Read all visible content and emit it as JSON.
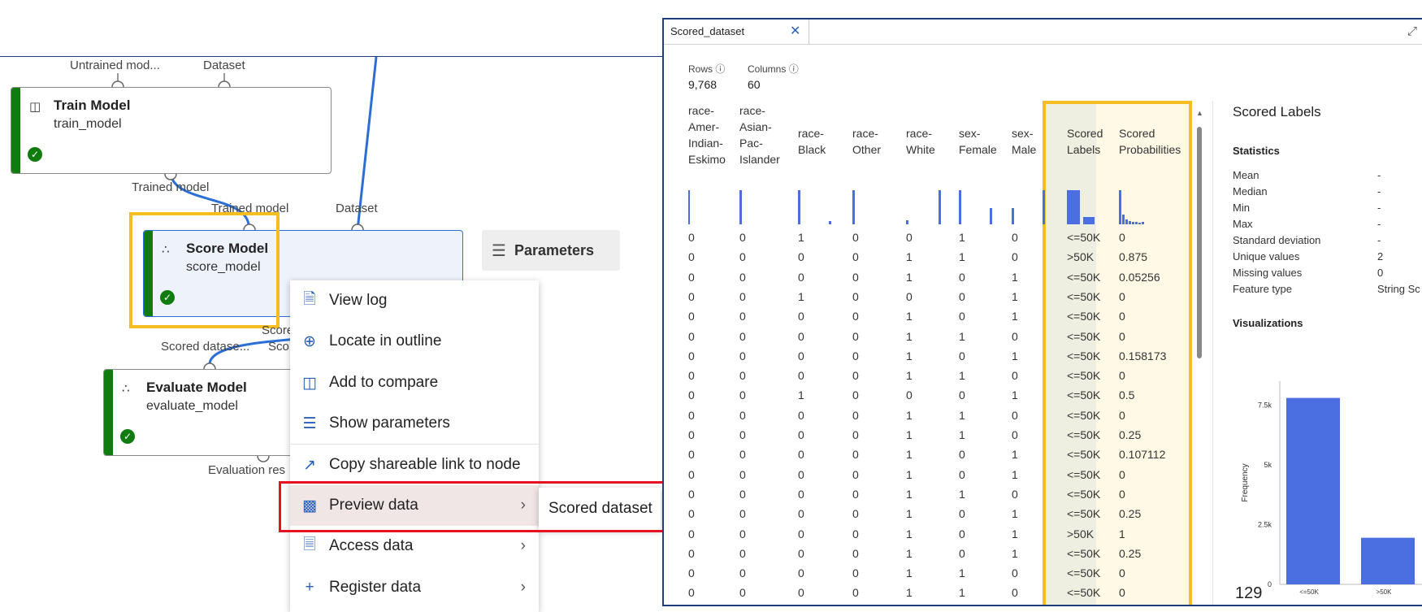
{
  "pipeline": {
    "top_ports": {
      "untrained": "Untrained mod...",
      "dataset": "Dataset"
    },
    "train_model": {
      "title": "Train Model",
      "subtitle": "train_model",
      "out_port": "Trained model"
    },
    "score_model": {
      "title": "Score Model",
      "subtitle": "score_model",
      "in_port_1": "Trained model",
      "in_port_2": "Dataset",
      "out_port": "Score"
    },
    "evaluate_model": {
      "title": "Evaluate Model",
      "subtitle": "evaluate_model",
      "in_port_1": "Scored datase...",
      "in_port_2": "Sco",
      "out_port": "Evaluation res"
    },
    "parameters_button": "Parameters"
  },
  "context_menu": {
    "items": [
      {
        "label": "View log",
        "icon": "document-icon"
      },
      {
        "label": "Locate in outline",
        "icon": "locate-icon"
      },
      {
        "label": "Add to compare",
        "icon": "compare-icon"
      },
      {
        "label": "Show parameters",
        "icon": "sliders-icon"
      },
      {
        "label": "Copy shareable link to node",
        "icon": "share-icon"
      },
      {
        "label": "Preview data",
        "icon": "bar-chart-icon"
      },
      {
        "label": "Access data",
        "icon": "file-lock-icon"
      },
      {
        "label": "Register data",
        "icon": "plus-icon"
      }
    ],
    "submenu_item": "Scored dataset"
  },
  "preview": {
    "tab_label": "Scored_dataset",
    "rows_label": "Rows",
    "rows_value": "9,768",
    "columns_label": "Columns",
    "columns_value": "60",
    "columns": [
      "race-\nAmer-\nIndian-\nEskimo",
      "race-\nAsian-\nPac-\nIslander",
      "race-\nBlack",
      "race-\nOther",
      "race-\nWhite",
      "sex-\nFemale",
      "sex-\nMale",
      "Scored\nLabels",
      "Scored\nProbabilities"
    ],
    "rows": [
      [
        "0",
        "0",
        "1",
        "0",
        "0",
        "1",
        "0",
        "<=50K",
        "0"
      ],
      [
        "0",
        "0",
        "0",
        "0",
        "1",
        "1",
        "0",
        ">50K",
        "0.875"
      ],
      [
        "0",
        "0",
        "0",
        "0",
        "1",
        "0",
        "1",
        "<=50K",
        "0.05256"
      ],
      [
        "0",
        "0",
        "1",
        "0",
        "0",
        "0",
        "1",
        "<=50K",
        "0"
      ],
      [
        "0",
        "0",
        "0",
        "0",
        "1",
        "0",
        "1",
        "<=50K",
        "0"
      ],
      [
        "0",
        "0",
        "0",
        "0",
        "1",
        "1",
        "0",
        "<=50K",
        "0"
      ],
      [
        "0",
        "0",
        "0",
        "0",
        "1",
        "0",
        "1",
        "<=50K",
        "0.158173"
      ],
      [
        "0",
        "0",
        "0",
        "0",
        "1",
        "1",
        "0",
        "<=50K",
        "0"
      ],
      [
        "0",
        "0",
        "1",
        "0",
        "0",
        "0",
        "1",
        "<=50K",
        "0.5"
      ],
      [
        "0",
        "0",
        "0",
        "0",
        "1",
        "1",
        "0",
        "<=50K",
        "0"
      ],
      [
        "0",
        "0",
        "0",
        "0",
        "1",
        "1",
        "0",
        "<=50K",
        "0.25"
      ],
      [
        "0",
        "0",
        "0",
        "0",
        "1",
        "0",
        "1",
        "<=50K",
        "0.107112"
      ],
      [
        "0",
        "0",
        "0",
        "0",
        "1",
        "0",
        "1",
        "<=50K",
        "0"
      ],
      [
        "0",
        "0",
        "0",
        "0",
        "1",
        "1",
        "0",
        "<=50K",
        "0"
      ],
      [
        "0",
        "0",
        "0",
        "0",
        "1",
        "0",
        "1",
        "<=50K",
        "0.25"
      ],
      [
        "0",
        "0",
        "0",
        "0",
        "1",
        "0",
        "1",
        ">50K",
        "1"
      ],
      [
        "0",
        "0",
        "0",
        "0",
        "1",
        "0",
        "1",
        "<=50K",
        "0.25"
      ],
      [
        "0",
        "0",
        "0",
        "0",
        "1",
        "1",
        "0",
        "<=50K",
        "0"
      ],
      [
        "0",
        "0",
        "0",
        "0",
        "1",
        "1",
        "0",
        "<=50K",
        "0"
      ]
    ],
    "stats_panel": {
      "title": "Scored Labels",
      "statistics_heading": "Statistics",
      "stats": [
        {
          "label": "Mean",
          "value": "-"
        },
        {
          "label": "Median",
          "value": "-"
        },
        {
          "label": "Min",
          "value": "-"
        },
        {
          "label": "Max",
          "value": "-"
        },
        {
          "label": "Standard deviation",
          "value": "-"
        },
        {
          "label": "Unique values",
          "value": "2"
        },
        {
          "label": "Missing values",
          "value": "0"
        },
        {
          "label": "Feature type",
          "value": "String Sc"
        }
      ],
      "visualizations_heading": "Visualizations",
      "page_number": "129"
    }
  },
  "chart_data": {
    "type": "bar",
    "categories": [
      "<=50K",
      ">50K"
    ],
    "values": [
      7800,
      1950
    ],
    "ylabel": "Frequency",
    "y_ticks": [
      "0",
      "2.5k",
      "5k",
      "7.5k"
    ],
    "ylim": [
      0,
      8500
    ]
  },
  "colors": {
    "accent": "#2b6fd6",
    "success": "#107c10",
    "highlight": "#f5bd1f",
    "focus": "#e81123",
    "bar": "#4b6ee0"
  }
}
